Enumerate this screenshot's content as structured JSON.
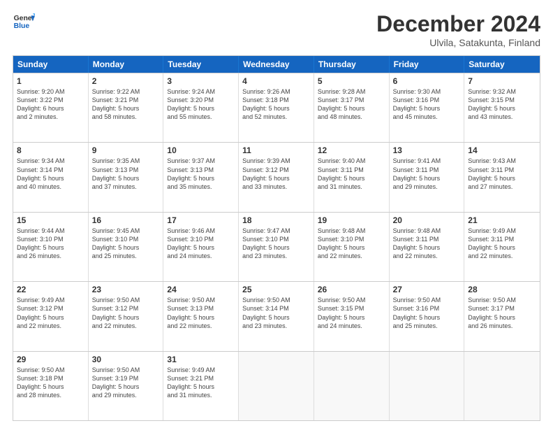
{
  "logo": {
    "line1": "General",
    "line2": "Blue"
  },
  "title": "December 2024",
  "subtitle": "Ulvila, Satakunta, Finland",
  "header_days": [
    "Sunday",
    "Monday",
    "Tuesday",
    "Wednesday",
    "Thursday",
    "Friday",
    "Saturday"
  ],
  "weeks": [
    [
      {
        "day": "1",
        "lines": [
          "Sunrise: 9:20 AM",
          "Sunset: 3:22 PM",
          "Daylight: 6 hours",
          "and 2 minutes."
        ]
      },
      {
        "day": "2",
        "lines": [
          "Sunrise: 9:22 AM",
          "Sunset: 3:21 PM",
          "Daylight: 5 hours",
          "and 58 minutes."
        ]
      },
      {
        "day": "3",
        "lines": [
          "Sunrise: 9:24 AM",
          "Sunset: 3:20 PM",
          "Daylight: 5 hours",
          "and 55 minutes."
        ]
      },
      {
        "day": "4",
        "lines": [
          "Sunrise: 9:26 AM",
          "Sunset: 3:18 PM",
          "Daylight: 5 hours",
          "and 52 minutes."
        ]
      },
      {
        "day": "5",
        "lines": [
          "Sunrise: 9:28 AM",
          "Sunset: 3:17 PM",
          "Daylight: 5 hours",
          "and 48 minutes."
        ]
      },
      {
        "day": "6",
        "lines": [
          "Sunrise: 9:30 AM",
          "Sunset: 3:16 PM",
          "Daylight: 5 hours",
          "and 45 minutes."
        ]
      },
      {
        "day": "7",
        "lines": [
          "Sunrise: 9:32 AM",
          "Sunset: 3:15 PM",
          "Daylight: 5 hours",
          "and 43 minutes."
        ]
      }
    ],
    [
      {
        "day": "8",
        "lines": [
          "Sunrise: 9:34 AM",
          "Sunset: 3:14 PM",
          "Daylight: 5 hours",
          "and 40 minutes."
        ]
      },
      {
        "day": "9",
        "lines": [
          "Sunrise: 9:35 AM",
          "Sunset: 3:13 PM",
          "Daylight: 5 hours",
          "and 37 minutes."
        ]
      },
      {
        "day": "10",
        "lines": [
          "Sunrise: 9:37 AM",
          "Sunset: 3:13 PM",
          "Daylight: 5 hours",
          "and 35 minutes."
        ]
      },
      {
        "day": "11",
        "lines": [
          "Sunrise: 9:39 AM",
          "Sunset: 3:12 PM",
          "Daylight: 5 hours",
          "and 33 minutes."
        ]
      },
      {
        "day": "12",
        "lines": [
          "Sunrise: 9:40 AM",
          "Sunset: 3:11 PM",
          "Daylight: 5 hours",
          "and 31 minutes."
        ]
      },
      {
        "day": "13",
        "lines": [
          "Sunrise: 9:41 AM",
          "Sunset: 3:11 PM",
          "Daylight: 5 hours",
          "and 29 minutes."
        ]
      },
      {
        "day": "14",
        "lines": [
          "Sunrise: 9:43 AM",
          "Sunset: 3:11 PM",
          "Daylight: 5 hours",
          "and 27 minutes."
        ]
      }
    ],
    [
      {
        "day": "15",
        "lines": [
          "Sunrise: 9:44 AM",
          "Sunset: 3:10 PM",
          "Daylight: 5 hours",
          "and 26 minutes."
        ]
      },
      {
        "day": "16",
        "lines": [
          "Sunrise: 9:45 AM",
          "Sunset: 3:10 PM",
          "Daylight: 5 hours",
          "and 25 minutes."
        ]
      },
      {
        "day": "17",
        "lines": [
          "Sunrise: 9:46 AM",
          "Sunset: 3:10 PM",
          "Daylight: 5 hours",
          "and 24 minutes."
        ]
      },
      {
        "day": "18",
        "lines": [
          "Sunrise: 9:47 AM",
          "Sunset: 3:10 PM",
          "Daylight: 5 hours",
          "and 23 minutes."
        ]
      },
      {
        "day": "19",
        "lines": [
          "Sunrise: 9:48 AM",
          "Sunset: 3:10 PM",
          "Daylight: 5 hours",
          "and 22 minutes."
        ]
      },
      {
        "day": "20",
        "lines": [
          "Sunrise: 9:48 AM",
          "Sunset: 3:11 PM",
          "Daylight: 5 hours",
          "and 22 minutes."
        ]
      },
      {
        "day": "21",
        "lines": [
          "Sunrise: 9:49 AM",
          "Sunset: 3:11 PM",
          "Daylight: 5 hours",
          "and 22 minutes."
        ]
      }
    ],
    [
      {
        "day": "22",
        "lines": [
          "Sunrise: 9:49 AM",
          "Sunset: 3:12 PM",
          "Daylight: 5 hours",
          "and 22 minutes."
        ]
      },
      {
        "day": "23",
        "lines": [
          "Sunrise: 9:50 AM",
          "Sunset: 3:12 PM",
          "Daylight: 5 hours",
          "and 22 minutes."
        ]
      },
      {
        "day": "24",
        "lines": [
          "Sunrise: 9:50 AM",
          "Sunset: 3:13 PM",
          "Daylight: 5 hours",
          "and 22 minutes."
        ]
      },
      {
        "day": "25",
        "lines": [
          "Sunrise: 9:50 AM",
          "Sunset: 3:14 PM",
          "Daylight: 5 hours",
          "and 23 minutes."
        ]
      },
      {
        "day": "26",
        "lines": [
          "Sunrise: 9:50 AM",
          "Sunset: 3:15 PM",
          "Daylight: 5 hours",
          "and 24 minutes."
        ]
      },
      {
        "day": "27",
        "lines": [
          "Sunrise: 9:50 AM",
          "Sunset: 3:16 PM",
          "Daylight: 5 hours",
          "and 25 minutes."
        ]
      },
      {
        "day": "28",
        "lines": [
          "Sunrise: 9:50 AM",
          "Sunset: 3:17 PM",
          "Daylight: 5 hours",
          "and 26 minutes."
        ]
      }
    ],
    [
      {
        "day": "29",
        "lines": [
          "Sunrise: 9:50 AM",
          "Sunset: 3:18 PM",
          "Daylight: 5 hours",
          "and 28 minutes."
        ]
      },
      {
        "day": "30",
        "lines": [
          "Sunrise: 9:50 AM",
          "Sunset: 3:19 PM",
          "Daylight: 5 hours",
          "and 29 minutes."
        ]
      },
      {
        "day": "31",
        "lines": [
          "Sunrise: 9:49 AM",
          "Sunset: 3:21 PM",
          "Daylight: 5 hours",
          "and 31 minutes."
        ]
      },
      null,
      null,
      null,
      null
    ]
  ]
}
